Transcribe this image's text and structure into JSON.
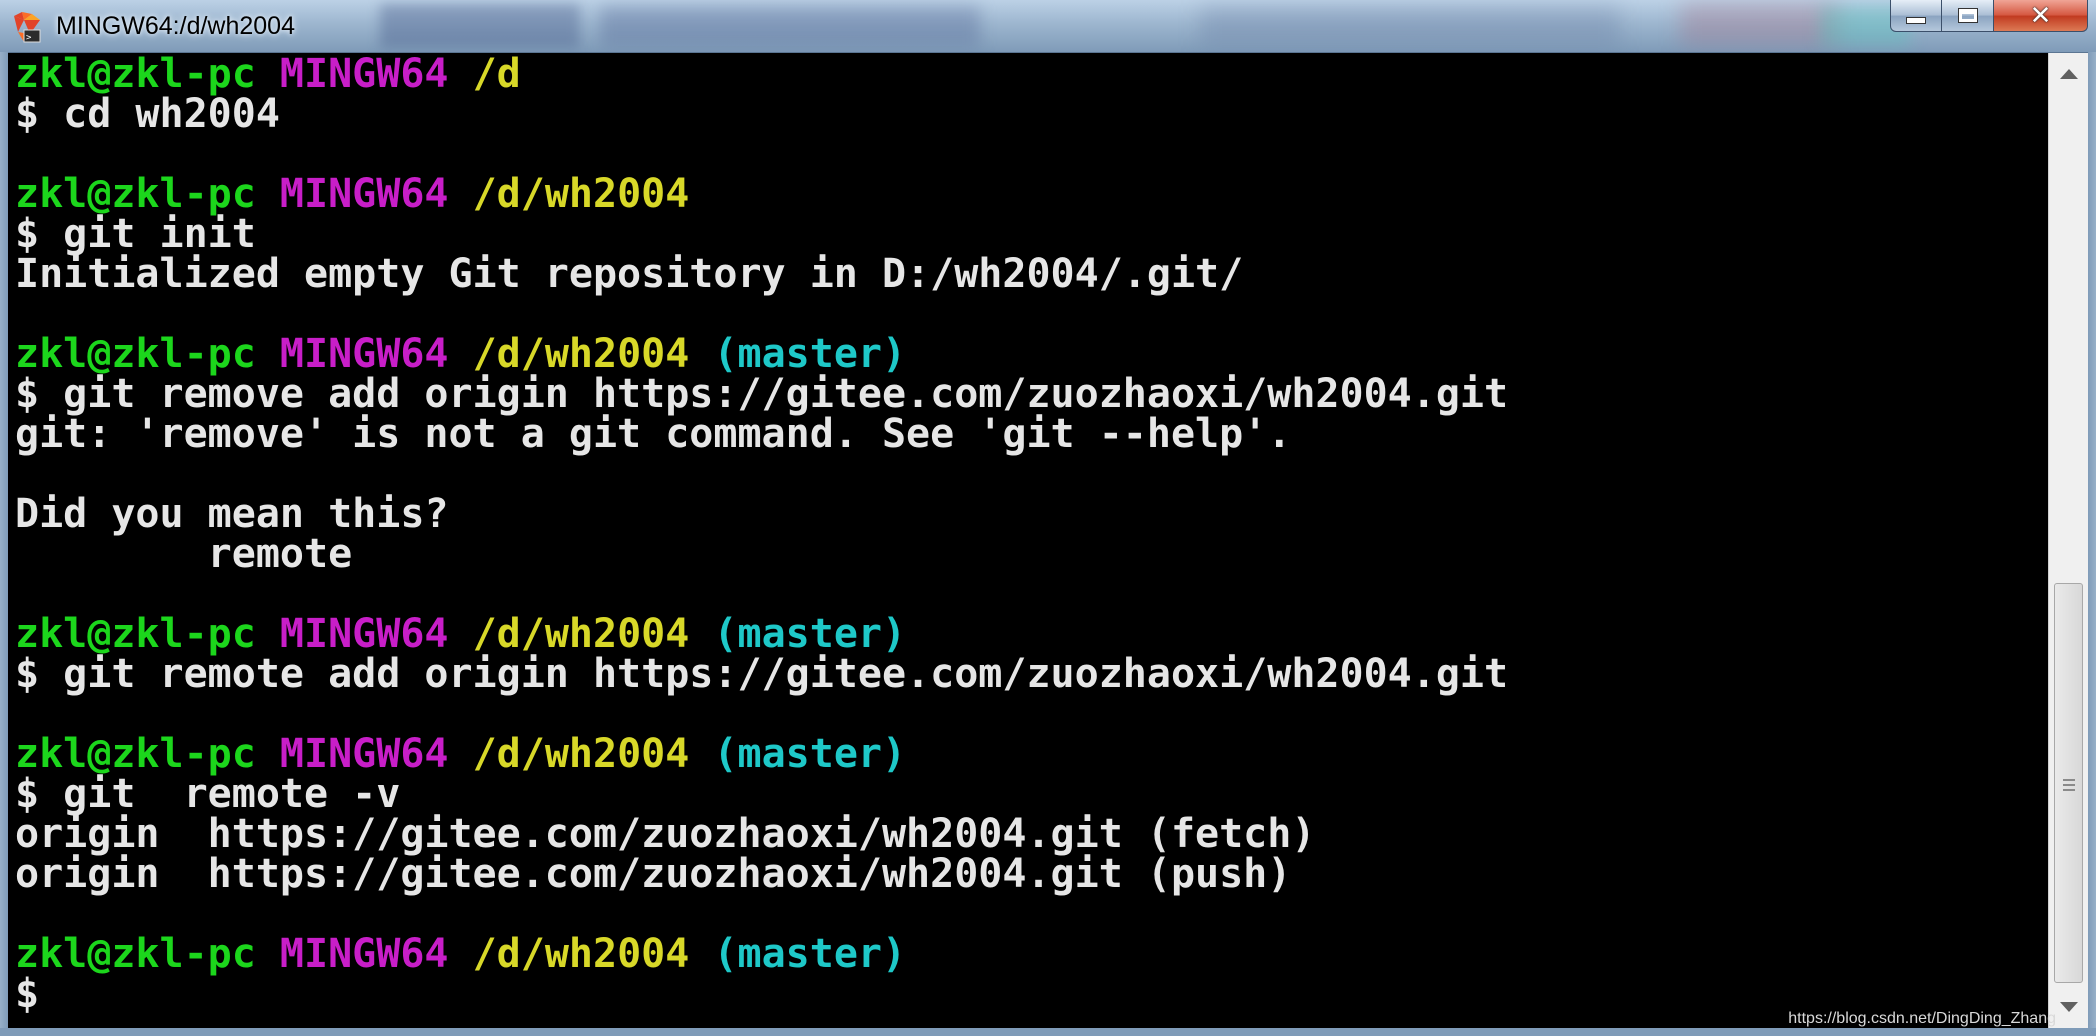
{
  "window": {
    "title": "MINGW64:/d/wh2004",
    "icon": "git-bash-icon",
    "controls": {
      "minimize": "minimize-icon",
      "maximize": "maximize-icon",
      "close": "close-icon"
    }
  },
  "colors": {
    "user_host": "#1cd61c",
    "mingw": "#c81ec8",
    "path": "#d8d828",
    "branch": "#1ec8c8",
    "text": "#e6e6e6",
    "background": "#000000"
  },
  "terminal": {
    "lines": [
      [
        {
          "t": "zkl@zkl-pc",
          "c": "green"
        },
        {
          "t": " ",
          "c": "white"
        },
        {
          "t": "MINGW64",
          "c": "magenta"
        },
        {
          "t": " ",
          "c": "white"
        },
        {
          "t": "/d",
          "c": "yellow"
        }
      ],
      [
        {
          "t": "$ cd wh2004",
          "c": "white"
        }
      ],
      [],
      [
        {
          "t": "zkl@zkl-pc",
          "c": "green"
        },
        {
          "t": " ",
          "c": "white"
        },
        {
          "t": "MINGW64",
          "c": "magenta"
        },
        {
          "t": " ",
          "c": "white"
        },
        {
          "t": "/d/wh2004",
          "c": "yellow"
        }
      ],
      [
        {
          "t": "$ git init",
          "c": "white"
        }
      ],
      [
        {
          "t": "Initialized empty Git repository in D:/wh2004/.git/",
          "c": "white"
        }
      ],
      [],
      [
        {
          "t": "zkl@zkl-pc",
          "c": "green"
        },
        {
          "t": " ",
          "c": "white"
        },
        {
          "t": "MINGW64",
          "c": "magenta"
        },
        {
          "t": " ",
          "c": "white"
        },
        {
          "t": "/d/wh2004",
          "c": "yellow"
        },
        {
          "t": " ",
          "c": "white"
        },
        {
          "t": "(master)",
          "c": "cyan"
        }
      ],
      [
        {
          "t": "$ git remove add origin https://gitee.com/zuozhaoxi/wh2004.git",
          "c": "white"
        }
      ],
      [
        {
          "t": "git: 'remove' is not a git command. See 'git --help'.",
          "c": "white"
        }
      ],
      [],
      [
        {
          "t": "Did you mean this?",
          "c": "white"
        }
      ],
      [
        {
          "t": "        remote",
          "c": "white"
        }
      ],
      [],
      [
        {
          "t": "zkl@zkl-pc",
          "c": "green"
        },
        {
          "t": " ",
          "c": "white"
        },
        {
          "t": "MINGW64",
          "c": "magenta"
        },
        {
          "t": " ",
          "c": "white"
        },
        {
          "t": "/d/wh2004",
          "c": "yellow"
        },
        {
          "t": " ",
          "c": "white"
        },
        {
          "t": "(master)",
          "c": "cyan"
        }
      ],
      [
        {
          "t": "$ git remote add origin https://gitee.com/zuozhaoxi/wh2004.git",
          "c": "white"
        }
      ],
      [],
      [
        {
          "t": "zkl@zkl-pc",
          "c": "green"
        },
        {
          "t": " ",
          "c": "white"
        },
        {
          "t": "MINGW64",
          "c": "magenta"
        },
        {
          "t": " ",
          "c": "white"
        },
        {
          "t": "/d/wh2004",
          "c": "yellow"
        },
        {
          "t": " ",
          "c": "white"
        },
        {
          "t": "(master)",
          "c": "cyan"
        }
      ],
      [
        {
          "t": "$ git  remote -v",
          "c": "white"
        }
      ],
      [
        {
          "t": "origin  https://gitee.com/zuozhaoxi/wh2004.git (fetch)",
          "c": "white"
        }
      ],
      [
        {
          "t": "origin  https://gitee.com/zuozhaoxi/wh2004.git (push)",
          "c": "white"
        }
      ],
      [],
      [
        {
          "t": "zkl@zkl-pc",
          "c": "green"
        },
        {
          "t": " ",
          "c": "white"
        },
        {
          "t": "MINGW64",
          "c": "magenta"
        },
        {
          "t": " ",
          "c": "white"
        },
        {
          "t": "/d/wh2004",
          "c": "yellow"
        },
        {
          "t": " ",
          "c": "white"
        },
        {
          "t": "(master)",
          "c": "cyan"
        }
      ],
      [
        {
          "t": "$",
          "c": "white"
        }
      ]
    ]
  },
  "scrollbar": {
    "up": "scroll-up-arrow-icon",
    "down": "scroll-down-arrow-icon"
  },
  "watermark": "https://blog.csdn.net/DingDing_Zhang"
}
